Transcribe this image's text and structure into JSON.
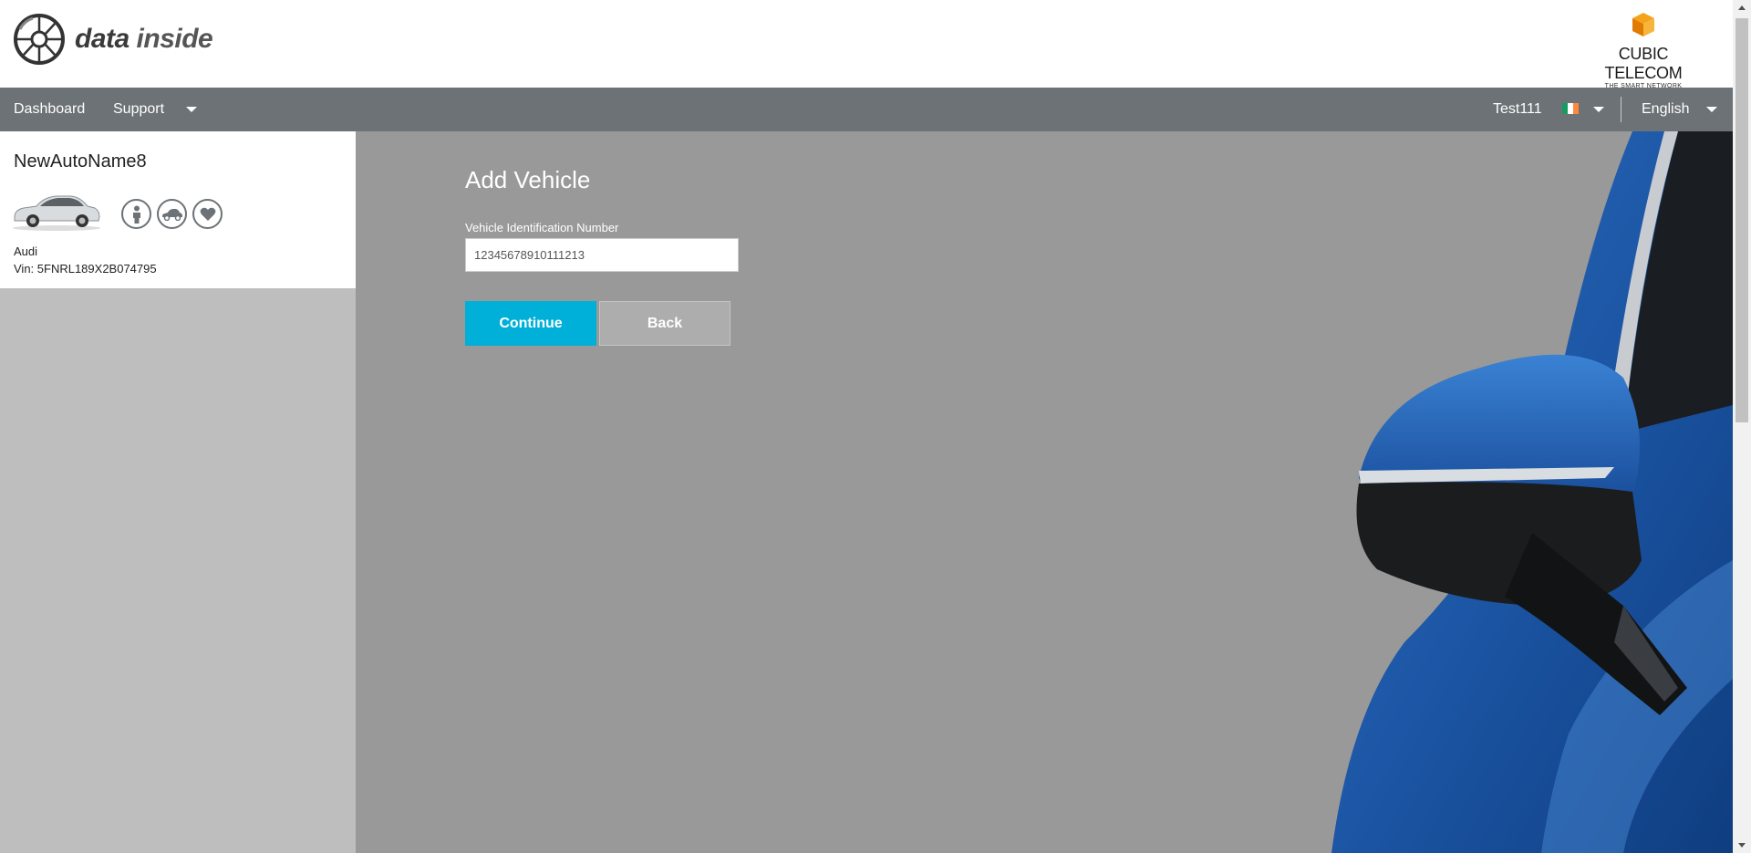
{
  "header": {
    "logo_word1": "data",
    "logo_word2": "inside",
    "partner_name": "CUBIC TELECOM",
    "partner_tagline": "THE SMART NETWORK"
  },
  "nav": {
    "dashboard": "Dashboard",
    "support": "Support",
    "user": "Test111",
    "language": "English"
  },
  "sidebar": {
    "vehicle": {
      "name": "NewAutoName8",
      "make": "Audi",
      "vin": "Vin: 5FNRL189X2B074795",
      "icons": [
        "person-icon",
        "car-icon",
        "heart-icon"
      ]
    }
  },
  "form": {
    "title": "Add Vehicle",
    "vin_label": "Vehicle Identification Number",
    "vin_value": "12345678910111213",
    "continue_label": "Continue",
    "back_label": "Back"
  },
  "colors": {
    "accent": "#00b0d9",
    "navbar": "#6c7276",
    "main_bg": "#999999",
    "sidebar_bg": "#bebebe"
  }
}
